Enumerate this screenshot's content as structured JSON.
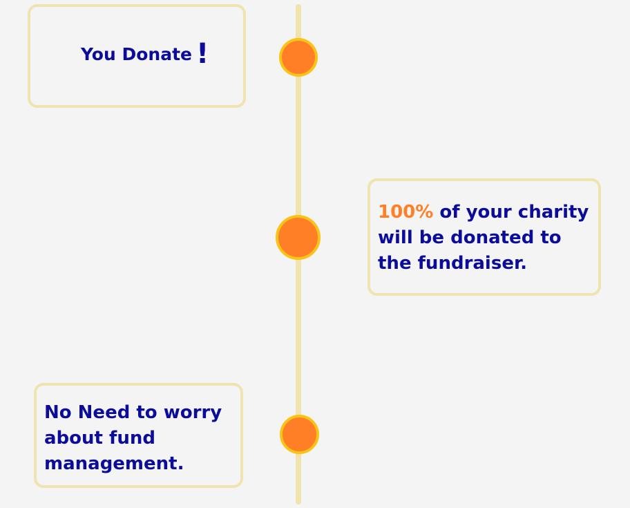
{
  "colors": {
    "background": "#f4f4f4",
    "timeline_line": "#efe3b0",
    "node_fill": "#ff7f27",
    "node_border": "#f7c417",
    "card_border": "#efe3b0",
    "text": "#0b0c9a",
    "accent": "#ff7f27"
  },
  "steps": [
    {
      "title": "You Donate",
      "mark": "!"
    },
    {
      "highlight": "100%",
      "line_1_rest": " of your charity",
      "line_2": "will be donated to",
      "line_3": "the fundraiser."
    },
    {
      "line_1": "No Need to worry",
      "line_2": "about fund",
      "line_3": "management."
    }
  ]
}
